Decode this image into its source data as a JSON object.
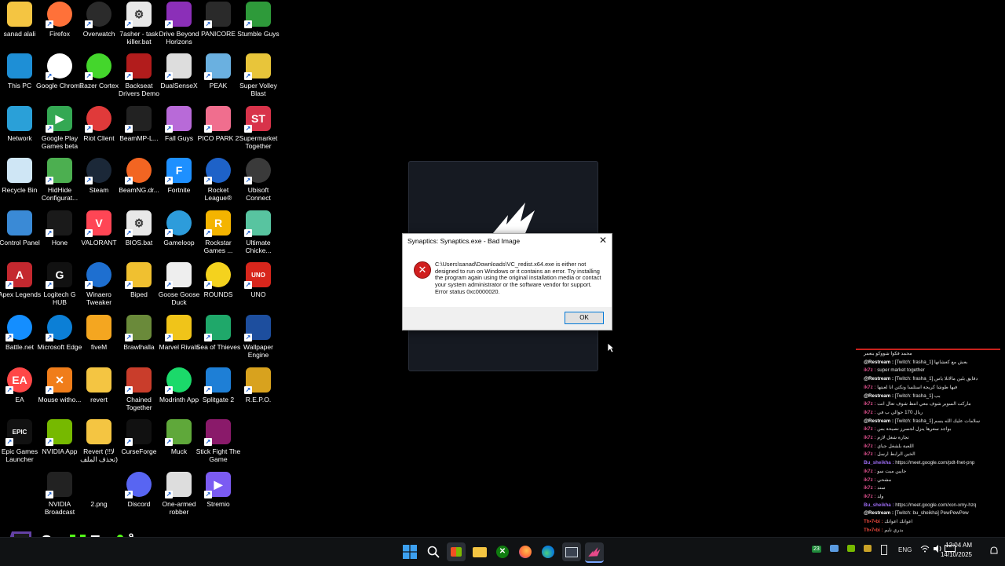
{
  "desktop": {
    "icons": [
      {
        "label": "sanad alali",
        "color": "#f4c542",
        "glyph": ""
      },
      {
        "label": "Firefox",
        "color": "#ff7139",
        "glyph": ""
      },
      {
        "label": "Overwatch",
        "color": "#2b2b2b",
        "glyph": ""
      },
      {
        "label": "7asher - task killer.bat",
        "color": "#e8e8e8",
        "glyph": "⚙"
      },
      {
        "label": "Drive Beyond Horizons",
        "color": "#8b2fb8",
        "glyph": ""
      },
      {
        "label": "PANICORE",
        "color": "#2a2a2a",
        "glyph": ""
      },
      {
        "label": "Stumble Guys",
        "color": "#2e9a3a",
        "glyph": ""
      },
      {
        "label": "This PC",
        "color": "#1e8fd6",
        "glyph": ""
      },
      {
        "label": "Google Chrome",
        "color": "#ffffff",
        "glyph": ""
      },
      {
        "label": "Razer Cortex",
        "color": "#44d62c",
        "glyph": ""
      },
      {
        "label": "Backseat Drivers Demo",
        "color": "#b21c1c",
        "glyph": ""
      },
      {
        "label": "DualSenseX",
        "color": "#dddddd",
        "glyph": ""
      },
      {
        "label": "PEAK",
        "color": "#6ab0e0",
        "glyph": ""
      },
      {
        "label": "Super Volley Blast",
        "color": "#e8c53a",
        "glyph": ""
      },
      {
        "label": "Network",
        "color": "#2aa0d8",
        "glyph": ""
      },
      {
        "label": "Google Play Games beta",
        "color": "#34a853",
        "glyph": "▶"
      },
      {
        "label": "Riot Client",
        "color": "#e03a3a",
        "glyph": ""
      },
      {
        "label": "BeamMP-L...",
        "color": "#222222",
        "glyph": ""
      },
      {
        "label": "Fall Guys",
        "color": "#b86ad8",
        "glyph": ""
      },
      {
        "label": "PICO PARK 2",
        "color": "#f06e8e",
        "glyph": ""
      },
      {
        "label": "Supermarket Together",
        "color": "#d8334a",
        "glyph": "ST"
      },
      {
        "label": "Recycle Bin",
        "color": "#cfe6f5",
        "glyph": ""
      },
      {
        "label": "HidHide Configurat...",
        "color": "#4caf50",
        "glyph": ""
      },
      {
        "label": "Steam",
        "color": "#1b2838",
        "glyph": ""
      },
      {
        "label": "BeamNG.dr...",
        "color": "#f26522",
        "glyph": ""
      },
      {
        "label": "Fortnite",
        "color": "#1e90ff",
        "glyph": "F"
      },
      {
        "label": "Rocket League®",
        "color": "#1e62c8",
        "glyph": ""
      },
      {
        "label": "Ubisoft Connect",
        "color": "#3a3a3a",
        "glyph": ""
      },
      {
        "label": "Control Panel",
        "color": "#3a8ad6",
        "glyph": ""
      },
      {
        "label": "Hone",
        "color": "#1a1a1a",
        "glyph": ""
      },
      {
        "label": "VALORANT",
        "color": "#ff4655",
        "glyph": "V"
      },
      {
        "label": "BIOS.bat",
        "color": "#e8e8e8",
        "glyph": "⚙"
      },
      {
        "label": "Gameloop",
        "color": "#2d9cdb",
        "glyph": ""
      },
      {
        "label": "Rockstar Games ...",
        "color": "#f4b400",
        "glyph": "R"
      },
      {
        "label": "Ultimate Chicke...",
        "color": "#58c4a0",
        "glyph": ""
      },
      {
        "label": "Apex Legends",
        "color": "#c4282f",
        "glyph": "A"
      },
      {
        "label": "Logitech G HUB",
        "color": "#111111",
        "glyph": "G"
      },
      {
        "label": "Winaero Tweaker",
        "color": "#1e6fd0",
        "glyph": ""
      },
      {
        "label": "Biped",
        "color": "#f0c030",
        "glyph": ""
      },
      {
        "label": "Goose Goose Duck",
        "color": "#eeeeee",
        "glyph": ""
      },
      {
        "label": "ROUNDS",
        "color": "#f4d21e",
        "glyph": ""
      },
      {
        "label": "UNO",
        "color": "#d8261c",
        "glyph": "UNO"
      },
      {
        "label": "Battle.net",
        "color": "#148eff",
        "glyph": ""
      },
      {
        "label": "Microsoft Edge",
        "color": "#0c7fd6",
        "glyph": ""
      },
      {
        "label": "fiveM",
        "color": "#f4a620",
        "glyph": ""
      },
      {
        "label": "Brawlhalla",
        "color": "#6a8a3a",
        "glyph": ""
      },
      {
        "label": "Marvel Rivals",
        "color": "#f0c419",
        "glyph": ""
      },
      {
        "label": "Sea of Thieves",
        "color": "#1fa86a",
        "glyph": ""
      },
      {
        "label": "Wallpaper Engine",
        "color": "#1d4e9e",
        "glyph": ""
      },
      {
        "label": "EA",
        "color": "#ff4747",
        "glyph": "EA"
      },
      {
        "label": "Mouse witho...",
        "color": "#f07d1a",
        "glyph": "✕"
      },
      {
        "label": "revert",
        "color": "#f4c542",
        "glyph": ""
      },
      {
        "label": "Chained Together",
        "color": "#c93d2b",
        "glyph": ""
      },
      {
        "label": "Modrinth App",
        "color": "#1bd96a",
        "glyph": ""
      },
      {
        "label": "Splitgate 2",
        "color": "#1e7fd6",
        "glyph": ""
      },
      {
        "label": "R.E.P.O.",
        "color": "#d8a21e",
        "glyph": ""
      },
      {
        "label": "Epic Games Launcher",
        "color": "#111111",
        "glyph": "EPIC"
      },
      {
        "label": "NVIDIA App",
        "color": "#76b900",
        "glyph": ""
      },
      {
        "label": "Revert (!!لا تحذف الملف)",
        "color": "#f4c542",
        "glyph": ""
      },
      {
        "label": "CurseForge",
        "color": "#111111",
        "glyph": ""
      },
      {
        "label": "Muck",
        "color": "#5fa83a",
        "glyph": ""
      },
      {
        "label": "Stick Fight The Game",
        "color": "#8a1a6a",
        "glyph": ""
      },
      {
        "label": "NVIDIA Broadcast",
        "color": "#222222",
        "glyph": ""
      },
      {
        "label": "2.png",
        "color": "#000000",
        "glyph": ""
      },
      {
        "label": "Discord",
        "color": "#5865f2",
        "glyph": ""
      },
      {
        "label": "One-armed robber",
        "color": "#dddddd",
        "glyph": ""
      },
      {
        "label": "Stremio",
        "color": "#7b5bf2",
        "glyph": "▶"
      }
    ]
  },
  "dialog": {
    "title": "Synaptics: Synaptics.exe - Bad Image",
    "close_label": "✕",
    "message": "C:\\Users\\sanad\\Downloads\\VC_redist.x64.exe is either not designed to run on Windows or it contains an error. Try installing the program again using the original installation media or contact your system administrator or the software vendor for support. Error status 0xc0000020.",
    "ok_label": "OK"
  },
  "chat": {
    "lines": [
      {
        "user": "",
        "text": "محمد فكوا شووكو بنعمر",
        "color": "#ffffff"
      },
      {
        "user": "@Restream :",
        "text": "[Twitch: frasha_1] بعش مع كعشانها",
        "color": "#ffffff"
      },
      {
        "user": "ik7z :",
        "text": "super market together",
        "color": "#d94e8a"
      },
      {
        "user": "@Restream :",
        "text": "[Twitch: frasha_1] دقايق بلين مالاتلا ياس",
        "color": "#ffffff"
      },
      {
        "user": "ik7z :",
        "text": "فيها طوشا كريجة استلسا ونكتن انا لعبتها",
        "color": "#d94e8a"
      },
      {
        "user": "@Restream :",
        "text": "[Twitch: frasha_1] بب",
        "color": "#ffffff"
      },
      {
        "user": "ik7z :",
        "text": "ماركت السوبر شوف معي انتظ شوف تعال انت",
        "color": "#d94e8a"
      },
      {
        "user": "ik7z :",
        "text": "ريال 170 حوالي ب في",
        "color": "#d94e8a"
      },
      {
        "user": "@Restream :",
        "text": "[Twitch: frasha_1] سلامات عليك الله يسم",
        "color": "#ffffff"
      },
      {
        "user": "ik7z :",
        "text": "بواجد سعرها ينزل لجسرز نصيحة بس",
        "color": "#d94e8a"
      },
      {
        "user": "ik7z :",
        "text": "تجارة شغل لازم",
        "color": "#d94e8a"
      },
      {
        "user": "ik7z :",
        "text": "اللعبة بلشغل جباي",
        "color": "#d94e8a"
      },
      {
        "user": "ik7z :",
        "text": "الخين الرابط ارسل",
        "color": "#d94e8a"
      },
      {
        "user": "Bu_sheikha :",
        "text": "https://meet.google.com/pdt-fnet-pnp",
        "color": "#9a6af0"
      },
      {
        "user": "ik7z :",
        "text": "جايين ميت سو",
        "color": "#d94e8a"
      },
      {
        "user": "ik7z :",
        "text": "مشحي",
        "color": "#d94e8a"
      },
      {
        "user": "ik7z :",
        "text": "سند",
        "color": "#d94e8a"
      },
      {
        "user": "ik7z :",
        "text": "ولد",
        "color": "#d94e8a"
      },
      {
        "user": "Bu_sheikha :",
        "text": "https://meet.google.com/xon-xmy-hzq",
        "color": "#9a6af0"
      },
      {
        "user": "@Restream :",
        "text": "[Twitch: bu_sheikha] PewPewPew",
        "color": "#ffffff"
      },
      {
        "user": "Th•7•bi :",
        "text": "اعوانك اعوانك",
        "color": "#e0453a"
      },
      {
        "user": "Th•7•bi :",
        "text": "بدري نايم",
        "color": "#e0453a"
      }
    ]
  },
  "overlay": {
    "count_a": "2",
    "count_b": "5",
    "count_c_top": "9",
    "count_c_bottom": "4"
  },
  "taskbar": {
    "tray_badge": "23",
    "language": "ENG",
    "time": "12:04 AM",
    "date": "14/10/2025"
  }
}
